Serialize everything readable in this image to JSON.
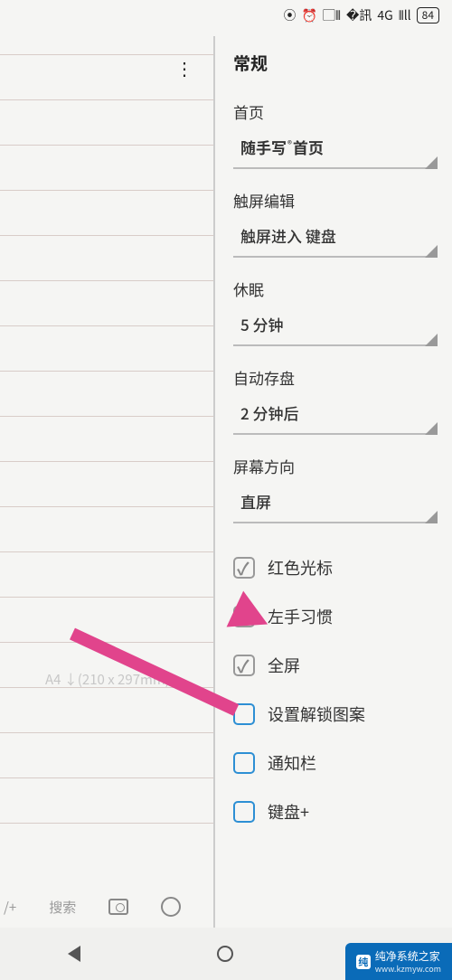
{
  "status": {
    "network": "4G",
    "battery": "84"
  },
  "left": {
    "paper_info": "A4 ↓(210 x 297mm)",
    "new_page": "/+",
    "search": "搜索"
  },
  "settings": {
    "title": "常规",
    "groups": [
      {
        "label": "首页",
        "value_pre": "随手写",
        "value_sup": "®",
        "value_post": "首页"
      },
      {
        "label": "触屏编辑",
        "value": "触屏进入 键盘"
      },
      {
        "label": "休眠",
        "value": "5 分钟"
      },
      {
        "label": "自动存盘",
        "value": "2 分钟后"
      },
      {
        "label": "屏幕方向",
        "value": "直屏"
      }
    ],
    "checks": [
      {
        "label": "红色光标",
        "checked": true,
        "blue": false
      },
      {
        "label": "左手习惯",
        "checked": true,
        "blue": false
      },
      {
        "label": "全屏",
        "checked": true,
        "blue": false
      },
      {
        "label": "设置解锁图案",
        "checked": false,
        "blue": true
      },
      {
        "label": "通知栏",
        "checked": false,
        "blue": true
      },
      {
        "label": "键盘+",
        "checked": false,
        "blue": true
      }
    ]
  },
  "watermark": {
    "title": "纯净系统之家",
    "sub": "www.kzmyw.com"
  }
}
